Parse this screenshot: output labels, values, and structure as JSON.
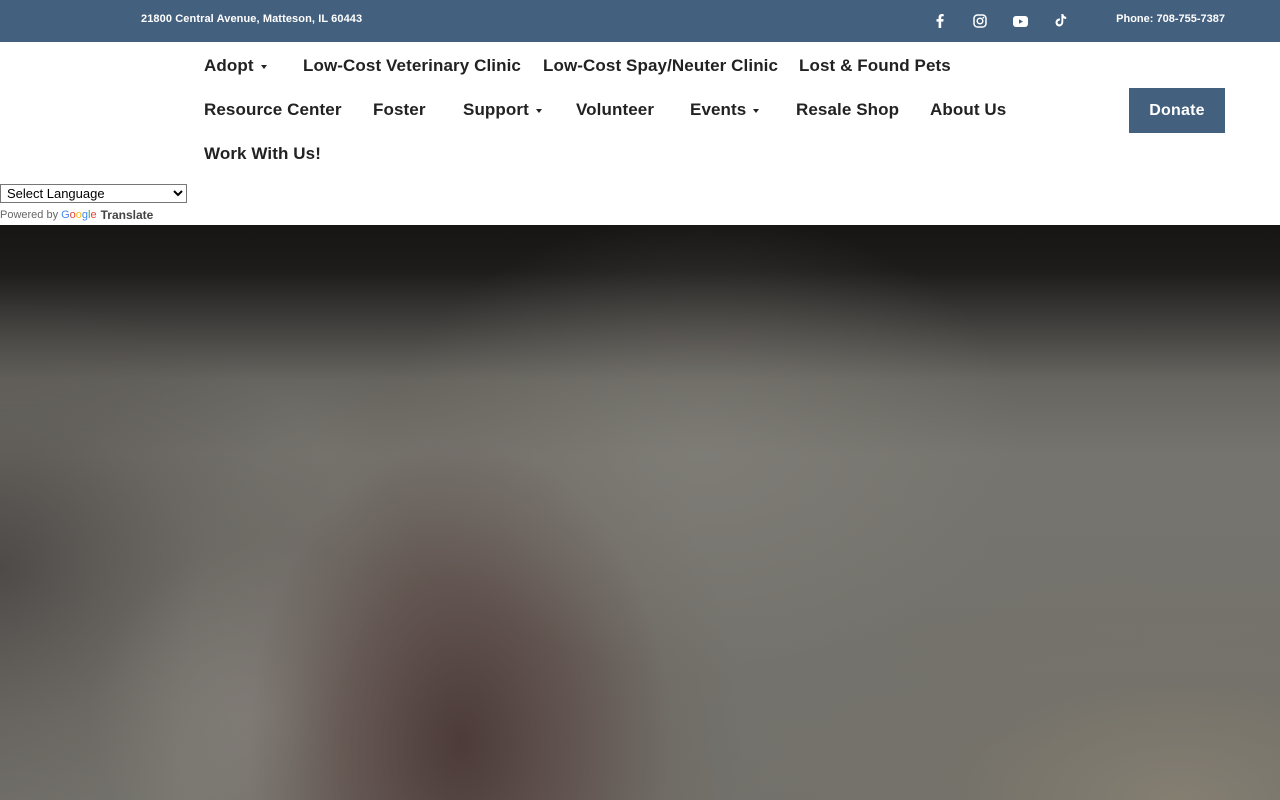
{
  "topbar": {
    "address": "21800 Central Avenue, Matteson, IL 60443",
    "phone": "Phone: 708-755-7387",
    "social_icons": [
      "facebook-icon",
      "instagram-icon",
      "youtube-icon",
      "tiktok-icon"
    ]
  },
  "nav": {
    "adopt": "Adopt",
    "vet_clinic": "Low-Cost Veterinary Clinic",
    "spay_neuter": "Low-Cost Spay/Neuter Clinic",
    "lost_found": "Lost & Found Pets",
    "resource_center": "Resource Center",
    "foster": "Foster",
    "support": "Support",
    "volunteer": "Volunteer",
    "events": "Events",
    "resale_shop": "Resale Shop",
    "about_us": "About Us",
    "work_with_us": "Work With Us!",
    "donate": "Donate"
  },
  "translate": {
    "select_label": "Select Language",
    "powered_by": "Powered by",
    "google": "Google",
    "translate": "Translate"
  },
  "colors": {
    "brand": "#43607e",
    "nav_text": "#222222"
  }
}
